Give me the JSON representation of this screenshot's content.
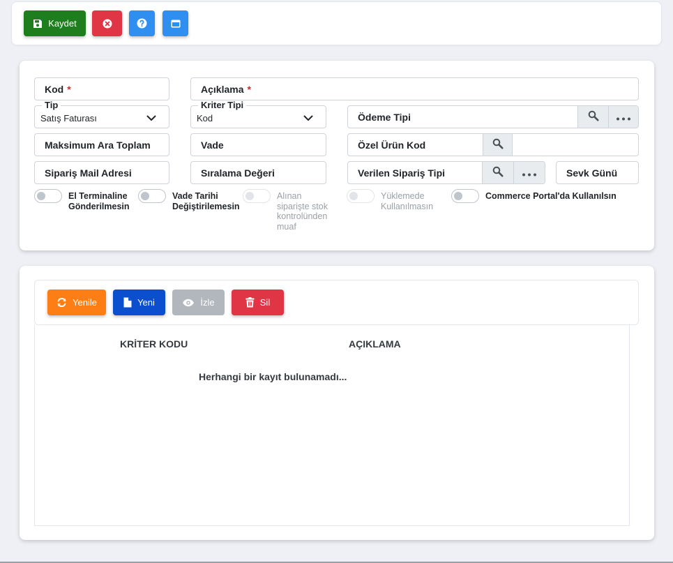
{
  "toolbar": {
    "save_label": "Kaydet",
    "save_icon": "save-icon",
    "cancel_icon": "close-circle-icon",
    "help_icon": "help-circle-icon",
    "window_icon": "window-icon"
  },
  "form": {
    "kod_label": "Kod",
    "aciklama_label": "Açıklama",
    "required_mark": "*",
    "tip_label": "Tip",
    "tip_value": "Satış Faturası",
    "kriter_tipi_label": "Kriter Tipi",
    "kriter_tipi_value": "Kod",
    "odeme_tipi_label": "Ödeme Tipi",
    "maks_ara_toplam_label": "Maksimum Ara Toplam",
    "vade_label": "Vade",
    "ozel_urun_kod_label": "Özel Ürün Kod",
    "siparis_mail_label": "Sipariş Mail Adresi",
    "siralama_degeri_label": "Sıralama Değeri",
    "verilen_siparis_tipi_label": "Verilen Sipariş Tipi",
    "sevk_gunu_label": "Sevk Günü"
  },
  "toggles": [
    {
      "line1": "El Terminaline",
      "line2": "Gönderilmesin",
      "line3": "",
      "line4": "",
      "disabled": false
    },
    {
      "line1": "Vade Tarihi",
      "line2": "Değiştirilemesin",
      "line3": "",
      "line4": "",
      "disabled": false
    },
    {
      "line1": "Alınan",
      "line2": "siparişte stok",
      "line3": "kontrolünden",
      "line4": "muaf",
      "disabled": true
    },
    {
      "line1": "Yüklemede",
      "line2": "Kullanılmasın",
      "line3": "",
      "line4": "",
      "disabled": true
    },
    {
      "line1": "Commerce Portal'da Kullanılsın",
      "line2": "",
      "line3": "",
      "line4": "",
      "disabled": false
    }
  ],
  "grid_toolbar": {
    "yenile_label": "Yenile",
    "yeni_label": "Yeni",
    "izle_label": "İzle",
    "sil_label": "Sil"
  },
  "table": {
    "columns": [
      "KRİTER KODU",
      "AÇIKLAMA"
    ],
    "empty_message": "Herhangi bir kayıt bulunamadı..."
  },
  "colors": {
    "save": "#1e7e1e",
    "cancel": "#e03545",
    "help": "#2e8ff0",
    "window": "#2e8ff0",
    "yenile": "#fd7e14",
    "yeni": "#0b4fcf",
    "izle": "#b2b7bd",
    "sil": "#e03545"
  }
}
